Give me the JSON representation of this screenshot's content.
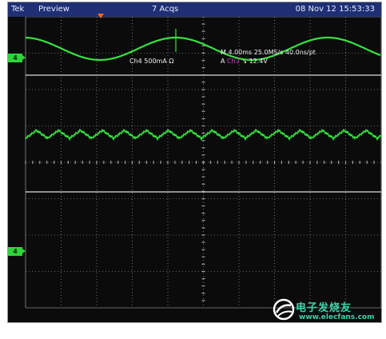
{
  "status_bar": {
    "brand": "Tek",
    "mode": "Preview",
    "acquisitions": "7 Acqs",
    "datetime": "08 Nov 12 15:53:33"
  },
  "channel_markers": [
    {
      "label": "4"
    },
    {
      "label": "4"
    }
  ],
  "readouts": {
    "channel_scale": "Ch4   500mA  Ω",
    "timebase": "M 4.00ms 25.0MS/s     40.0ns/pt",
    "trigger_prefix": "A",
    "trigger_channel": "Ch3",
    "trigger_slope": "↘",
    "trigger_level": "12.4V"
  },
  "watermark": {
    "brand_text": "电子发烧友",
    "url": "www.elecfans.com"
  },
  "colors": {
    "trace": "#36e23f",
    "graticule": "#bdbdbd",
    "status_bar": "#1e2f74",
    "trigger_marker": "#e86a2a"
  }
}
